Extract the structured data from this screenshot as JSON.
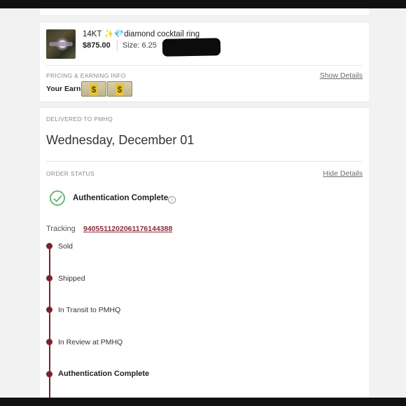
{
  "item": {
    "title": "14KT ✨💎diamond cocktail ring",
    "price": "$875.00",
    "size": "Size: 6.25"
  },
  "pricing": {
    "section_label": "PRICING & EARNING INFO",
    "show_details": "Show Details",
    "earnings_label": "Your Earni",
    "bill_glyph": "$"
  },
  "delivery": {
    "section_label": "DELIVERED TO PMHQ",
    "date": "Wednesday, December 01"
  },
  "order_status": {
    "section_label": "ORDER STATUS",
    "hide_details": "Hide Details",
    "status": "Authentication Complete",
    "info_glyph": "i",
    "tracking_label": "Tracking",
    "tracking_number": "9405511202061176144388",
    "steps": [
      {
        "label": "Sold"
      },
      {
        "label": "Shipped"
      },
      {
        "label": "In Transit to PMHQ"
      },
      {
        "label": "In Review at PMHQ"
      },
      {
        "label": "Authentication Complete"
      }
    ]
  },
  "colors": {
    "accent": "#7a2230",
    "check": "#6ab87a"
  }
}
